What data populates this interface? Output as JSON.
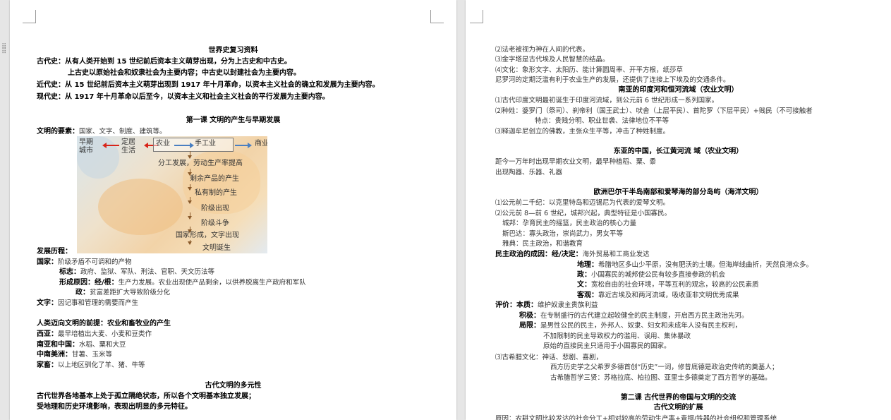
{
  "left_page": {
    "title": "世界史复习资料",
    "periods": [
      "古代史：从有人类开始到 15 世纪前后资本主义萌芽出现，分为上古史和中古史。",
      "上古史以原始社会和奴隶社会为主要内容；中古史以封建社会为主要内容。",
      "近代史：从 15 世纪前后资本主义萌芽出现到 1917 年十月革命，以资本主义社会的确立和发展为主要内容。",
      "现代史：从 1917 年十月革命以后至今，以资本主义和社会主义社会的平行发展为主要内容。"
    ],
    "lesson1_title": "第一课  文明的产生与早期发展",
    "elements_label": "文明的要素：",
    "elements_text": "国家、文字、制度、建筑等。",
    "diagram": {
      "early_city": [
        "早期",
        "城市"
      ],
      "settled": [
        "定居",
        "生活"
      ],
      "agriculture": "农业",
      "handicraft": "手工业",
      "commerce": "商业",
      "steps": [
        "分工发展，劳动生产率提高",
        "剩余产品的产生",
        "私有制的产生",
        "阶级出现",
        "阶级斗争",
        "国家形成",
        "文字出现",
        "文明诞生"
      ]
    },
    "history_label": "发展历程：",
    "state_label": "国家：",
    "state_text": "阶级矛盾不可调和的产物",
    "marks_label": "标志：",
    "marks_text": "政府、监狱、军队、刑法、官职、天文历法等",
    "cause_label": "形成原因：经/根：",
    "cause_text": "生产力发展。农业出现使产品剩余，以供养脱离生产政府和军队",
    "cause_zheng_label": "政：",
    "cause_zheng_text": "贫富差距扩大导致阶级分化",
    "writing_label": "文字：",
    "writing_text": "因记事和管理的需要而产生",
    "premise_title": "人类迈向文明的前提：农业和畜牧业的产生",
    "regions": [
      {
        "label": "西亚：",
        "text": "最早培植出大麦、小麦和豆类作"
      },
      {
        "label": "南亚和中国：",
        "text": "水稻、粟和大豆"
      },
      {
        "label": "中南美洲：",
        "text": "甘薯、玉米等"
      },
      {
        "label": "家畜：",
        "text": "以上地区驯化了羊、猪、牛等"
      }
    ],
    "diversity_title": "古代文明的多元性",
    "diversity_lines": [
      "古代世界各地基本上处于孤立隔绝状态，所以各个文明基本独立发展；",
      "受地理和历史环境影响，表现出明显的多元特征。"
    ]
  },
  "right_page": {
    "egypt_lines": [
      "⑵法老被视为神在人间的代表。",
      "⑶金字塔是古代埃及人民智慧的结晶。",
      "⑷文化：象形文字、太阳历、能计算圆周率、开平方根，纸莎草",
      "尼罗河的定期泛滥有利于农业生产的发展，还提供了连接上下埃及的交通条件。"
    ],
    "india_title": "南亚的印度河和恒河流域（农业文明）",
    "india_lines": [
      "⑴古代印度文明最初诞生于印度河流域，到公元前 6 世纪形成一系列国家。",
      "⑵种姓：婆罗门（祭司）、刹帝利（国王武士）、吠舍（上层平民）、首陀罗（下层平民）+贱民（不可接触者",
      "特点：贵贱分明、职业世袭、法律地位不平等",
      "⑶释迦牟尼创立的佛教，主张众生平等，冲击了种姓制度。"
    ],
    "china_title": "东亚的中国，长江黄河流  域（农业文明）",
    "china_lines": [
      "距今一万年时出现早期农业文明，最早种植稻、粟、黍",
      "出现陶器、乐器、礼器"
    ],
    "greece_title": "欧洲巴尔干半岛南部和爱琴海的部分岛屿（海洋文明）",
    "greece_lines": [
      "⑴公元前二千纪：以克里特岛和迈锡尼为代表的爱琴文明。",
      "⑵公元前 8—前 6 世纪，城邦兴起，典型特征是小国寡民。",
      "城邦：孕育民主的摇篮，民主政治的核心力量",
      "斯巴达：寡头政治，崇尚武力，男女平等",
      "雅典：民主政治，和谐教育"
    ],
    "democracy_label": "民主政治的成因：",
    "democracy_rows": [
      {
        "label": "经/决定：",
        "text": "海外贸易和工商业发达"
      },
      {
        "label": "地理：",
        "text": "希腊地区多山少平原，没有肥沃的土壤。但海岸线曲折，天然良港众多。"
      },
      {
        "label": "政：",
        "text": "小国寡民的城邦使公民有较多直接参政的机会"
      },
      {
        "label": "文：",
        "text": "宽松自由的社会环境，平等互利的观念，较高的公民素质"
      },
      {
        "label": "客观：",
        "text": "靠近古埃及和两河流域，吸收亚非文明优秀成果"
      }
    ],
    "eval_label": "评价：",
    "eval_rows": [
      {
        "label": "本质：",
        "text": "维护奴隶主贵族利益"
      },
      {
        "label": "积极：",
        "text": "在专制盛行的古代建立起较健全的民主制度，开启西方民主政治先河。"
      },
      {
        "label": "局限：",
        "text": "是男性公民的民主，外邦人、奴隶、妇女和未成年人没有民主权利，"
      },
      {
        "label": "",
        "text": "不加限制的民主导致权力的滥用、误用、集体暴政"
      },
      {
        "label": "",
        "text": "原始的直接民主只适用于小国寡民的国家。"
      }
    ],
    "culture_lines": [
      "⑶古希腊文化：神话、悲剧、喜剧，",
      "西方历史学之父希罗多德首创“历史”一词，修昔底德是政治史传统的奠基人；",
      "古希腊哲学三贤：苏格拉底、柏拉图、亚里士多德奠定了西方哲学的基础。"
    ],
    "lesson2_title": "第二课  古代世界的帝国与文明的交流",
    "lesson2_subtitle": "古代文明的扩展",
    "last_line": "原因：农耕文明比较发达的社会分工+相对较高的劳动生产率+青铜/铁器的社会组织和管理系统"
  }
}
